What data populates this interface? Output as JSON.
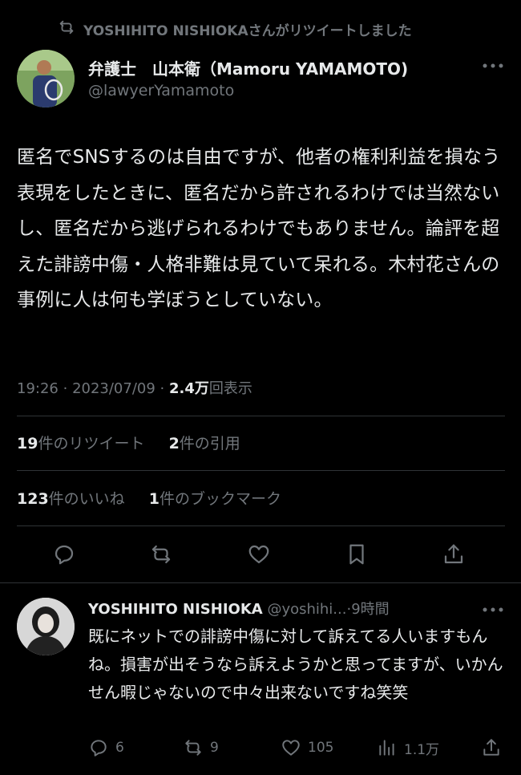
{
  "retweet_banner": {
    "text": "YOSHIHITO NISHIOKAさんがリツイートしました",
    "icon": "retweet-icon"
  },
  "tweet": {
    "author_name": "弁護士　山本衛（Mamoru YAMAMOTO)",
    "author_handle": "@lawyerYamamoto",
    "text": "匿名でSNSするのは自由ですが、他者の権利利益を損なう表現をしたときに、匿名だから許されるわけでは当然ないし、匿名だから逃げられるわけでもありません。論評を超えた誹謗中傷・人格非難は見ていて呆れる。木村花さんの事例に人は何も学ぼうとしていない。",
    "time": "19:26",
    "date": "2023/07/09",
    "views_count": "2.4万",
    "views_label": "回表示",
    "retweets_count": "19",
    "retweets_label": "件のリツイート",
    "quotes_count": "2",
    "quotes_label": "件の引用",
    "likes_count": "123",
    "likes_label": "件のいいね",
    "bookmarks_count": "1",
    "bookmarks_label": "件のブックマーク"
  },
  "actions": [
    "reply-icon",
    "retweet-icon",
    "like-icon",
    "bookmark-icon",
    "share-icon"
  ],
  "reply": {
    "author_name": "YOSHIHITO NISHIOKA",
    "author_handle": "@yoshihi...",
    "separator": "·",
    "time": "9時間",
    "text": "既にネットでの誹謗中傷に対して訴えてる人いますもんね。損害が出そうなら訴えようかと思ってますが、いかんせん暇じゃないので中々出来ないですね笑笑",
    "reply_count": "6",
    "retweet_count": "9",
    "like_count": "105",
    "view_count": "1.1万"
  },
  "colors": {
    "background": "#000000",
    "text": "#e7e9ea",
    "muted": "#71767b",
    "divider": "#2f3336"
  }
}
